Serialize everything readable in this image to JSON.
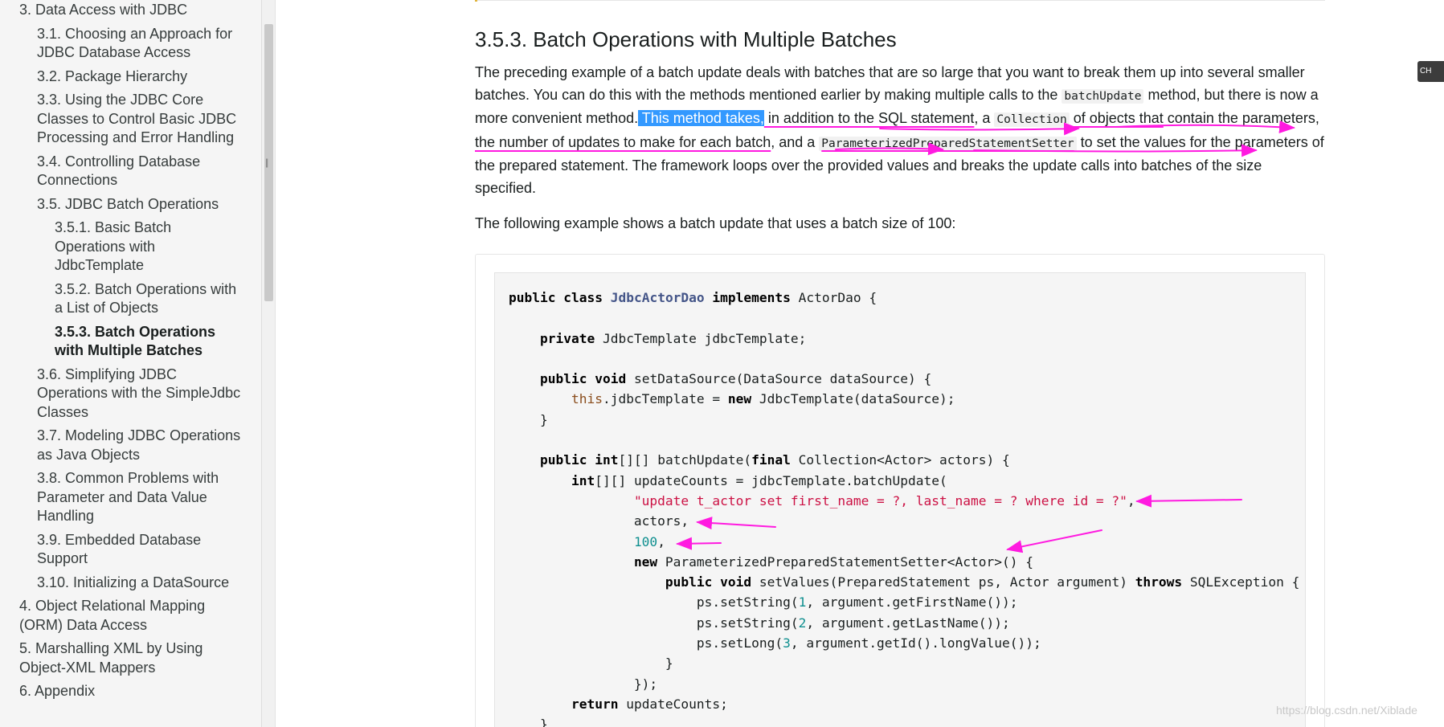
{
  "sidebar": {
    "items": [
      {
        "label": "3. Data Access with JDBC",
        "level": 1
      },
      {
        "label": "3.1. Choosing an Approach for JDBC Database Access",
        "level": 2
      },
      {
        "label": "3.2. Package Hierarchy",
        "level": 2
      },
      {
        "label": "3.3. Using the JDBC Core Classes to Control Basic JDBC Processing and Error Handling",
        "level": 2
      },
      {
        "label": "3.4. Controlling Database Connections",
        "level": 2
      },
      {
        "label": "3.5. JDBC Batch Operations",
        "level": 2
      },
      {
        "label": "3.5.1. Basic Batch Operations with JdbcTemplate",
        "level": 3
      },
      {
        "label": "3.5.2. Batch Operations with a List of Objects",
        "level": 3
      },
      {
        "label": "3.5.3. Batch Operations with Multiple Batches",
        "level": 3,
        "active": true
      },
      {
        "label": "3.6. Simplifying JDBC Operations with the SimpleJdbc Classes",
        "level": 2
      },
      {
        "label": "3.7. Modeling JDBC Operations as Java Objects",
        "level": 2
      },
      {
        "label": "3.8. Common Problems with Parameter and Data Value Handling",
        "level": 2
      },
      {
        "label": "3.9. Embedded Database Support",
        "level": 2
      },
      {
        "label": "3.10. Initializing a DataSource",
        "level": 2
      },
      {
        "label": "4. Object Relational Mapping (ORM) Data Access",
        "level": 1
      },
      {
        "label": "5. Marshalling XML by Using Object-XML Mappers",
        "level": 1
      },
      {
        "label": "6. Appendix",
        "level": 1
      }
    ]
  },
  "main": {
    "section_title": "3.5.3. Batch Operations with Multiple Batches",
    "p1": {
      "t1": "The preceding example of a batch update deals with batches that are so large that you want to break them up into several smaller batches. You can do this with the methods mentioned earlier by making multiple calls to the ",
      "c1": "batchUpdate",
      "t2": " method, but there is now a more convenient method.",
      "sel": " This method takes,",
      "u1": " in addition to the SQL statement",
      "t3": ", a ",
      "c2": "Collection",
      "u2": " of objects that",
      "t4": " contain the parameters, ",
      "u3": "the number of updates to make for each batch",
      "t5": ", and a ",
      "c3": "ParameterizedPreparedStatementSetter",
      "t6": " to set the values for the parameters of the prepared statement. The framework loops over the provided values and breaks the update calls into batches of the size specified."
    },
    "p2": "The following example shows a batch update that uses a batch size of 100:",
    "code": [
      "public class JdbcActorDao implements ActorDao {",
      "",
      "    private JdbcTemplate jdbcTemplate;",
      "",
      "    public void setDataSource(DataSource dataSource) {",
      "        this.jdbcTemplate = new JdbcTemplate(dataSource);",
      "    }",
      "",
      "    public int[][] batchUpdate(final Collection<Actor> actors) {",
      "        int[][] updateCounts = jdbcTemplate.batchUpdate(",
      "                \"update t_actor set first_name = ?, last_name = ? where id = ?\",",
      "                actors,",
      "                100,",
      "                new ParameterizedPreparedStatementSetter<Actor>() {",
      "                    public void setValues(PreparedStatement ps, Actor argument) throws SQLException {",
      "                        ps.setString(1, argument.getFirstName());",
      "                        ps.setString(2, argument.getLastName());",
      "                        ps.setLong(3, argument.getId().longValue());",
      "                    }",
      "                });",
      "        return updateCounts;",
      "    }"
    ]
  },
  "right_tab": "CH",
  "watermark": "https://blog.csdn.net/Xiblade",
  "colors": {
    "annotation": "#ff1ae0",
    "selection": "#3399ff",
    "keyword": "#000000",
    "type": "#445588",
    "string": "#cc1144",
    "number": "#0f8f8f",
    "this": "#8a4d1c"
  }
}
